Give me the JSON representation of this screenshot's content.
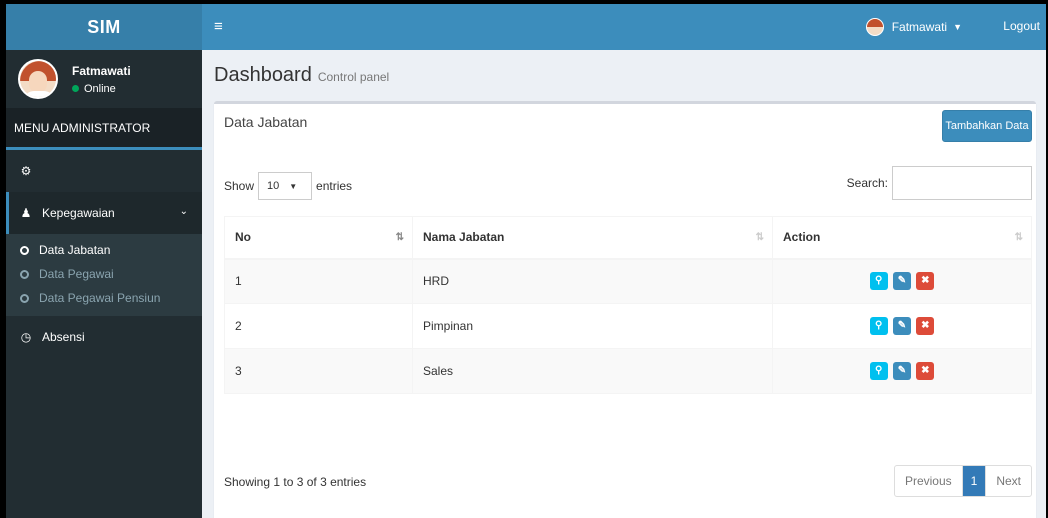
{
  "app": {
    "title": "SIM"
  },
  "user": {
    "name": "Fatmawati",
    "status": "Online"
  },
  "sidebar": {
    "header": "MENU ADMINISTRATOR",
    "items": [
      {
        "label": "",
        "icon": "dashboard-icon"
      },
      {
        "label": "Kepegawaian",
        "icon": "user-icon"
      },
      {
        "label": "Absensi",
        "icon": "clock-icon"
      }
    ],
    "submenu": [
      "Data Jabatan",
      "Data Pegawai",
      "Data Pegawai Pensiun"
    ]
  },
  "navbar": {
    "toggle_icon": "menu-icon",
    "user_name": "Fatmawati",
    "logout": "Logout"
  },
  "page": {
    "title": "Dashboard",
    "subtitle": "Control panel"
  },
  "box": {
    "title": "Data Jabatan",
    "add_button": "Tambahkan Data",
    "show_label": "Show",
    "entries_value": "10",
    "entries_label": "entries",
    "search_label": "Search:",
    "columns": [
      "No",
      "Nama Jabatan",
      "Action"
    ],
    "rows": [
      {
        "no": "1",
        "nama": "HRD"
      },
      {
        "no": "2",
        "nama": "Pimpinan"
      },
      {
        "no": "3",
        "nama": "Sales"
      }
    ],
    "info": "Showing 1 to 3 of 3 entries",
    "pagination": {
      "previous": "Previous",
      "current": "1",
      "next": "Next"
    }
  },
  "colors": {
    "brand": "#3c8dbc",
    "sidebar": "#222d32",
    "danger": "#dd4b39",
    "info": "#00c0ef"
  }
}
